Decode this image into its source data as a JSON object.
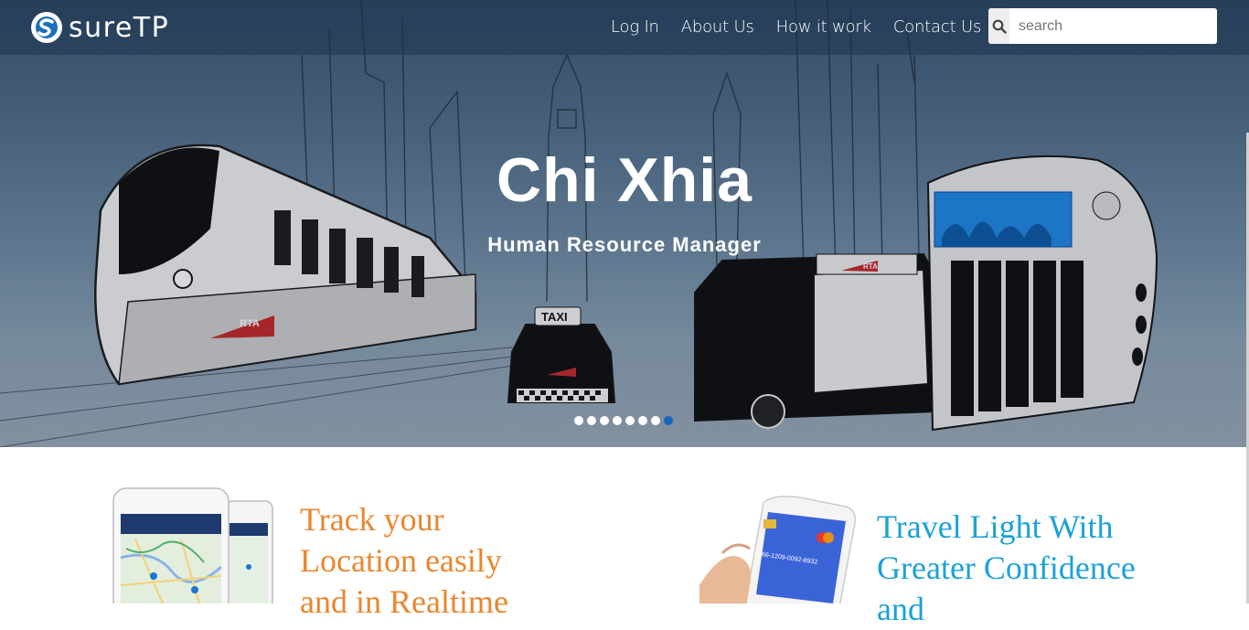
{
  "brand": {
    "name": "sureTP",
    "logo_icon": "s-circle-logo-icon"
  },
  "nav": {
    "links": [
      {
        "label": "Log In"
      },
      {
        "label": "About Us"
      },
      {
        "label": "How it work"
      },
      {
        "label": "Contact Us"
      }
    ],
    "search": {
      "placeholder": "search",
      "icon": "search-icon"
    }
  },
  "hero": {
    "title": "Chi Xhia",
    "subtitle": "Human Resource Manager",
    "slides_total": 8,
    "active_slide": 8,
    "illustration_labels": {
      "taxi_sign": "TAXI",
      "train_logo": "RTA",
      "car_logo": "RTA",
      "bus_logo": "RTA"
    }
  },
  "features": [
    {
      "text": "Track your Location easily and in Realtime",
      "image": "phones-map-illustration"
    },
    {
      "text": "Travel Light With Greater Confidence and",
      "image": "hand-holding-phone-card-illustration"
    }
  ],
  "colors": {
    "accent_blue": "#1565c0",
    "feature_orange": "#e9862e",
    "feature_blue": "#1ba1d8"
  }
}
